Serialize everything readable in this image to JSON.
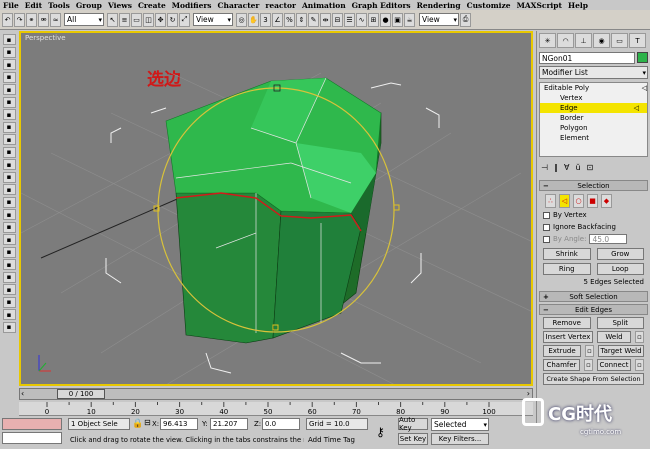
{
  "menu": [
    "File",
    "Edit",
    "Tools",
    "Group",
    "Views",
    "Create",
    "Modifiers",
    "Character",
    "reactor",
    "Animation",
    "Graph Editors",
    "Rendering",
    "Customize",
    "MAXScript",
    "Help"
  ],
  "toolbar": {
    "filter_select": "All",
    "coord_select": "View",
    "view_select_right": "View"
  },
  "viewport": {
    "label": "Perspective",
    "annotation": "选边"
  },
  "panel": {
    "object_name": "NGon01",
    "object_color": "#2db34a",
    "modifier_list": "Modifier List",
    "stack": {
      "root": "Editable Poly",
      "items": [
        "Vertex",
        "Edge",
        "Border",
        "Polygon",
        "Element"
      ],
      "selected": "Edge"
    },
    "selection": {
      "title": "Selection",
      "by_vertex": "By Vertex",
      "ignore_backfacing": "Ignore Backfacing",
      "by_angle": "By Angle:",
      "angle_value": "45.0",
      "shrink": "Shrink",
      "grow": "Grow",
      "ring": "Ring",
      "loop": "Loop",
      "status": "5 Edges Selected"
    },
    "soft_selection": "Soft Selection",
    "edit_edges": {
      "title": "Edit Edges",
      "remove": "Remove",
      "split": "Split",
      "insert_vertex": "Insert Vertex",
      "weld": "Weld",
      "extrude": "Extrude",
      "target_weld": "Target Weld",
      "chamfer": "Chamfer",
      "connect": "Connect",
      "create_shape": "Create Shape From Selection"
    }
  },
  "timeline": {
    "frame": "0 / 100",
    "ticks": [
      "0",
      "10",
      "20",
      "30",
      "40",
      "50",
      "60",
      "70",
      "80",
      "90",
      "100"
    ]
  },
  "status": {
    "selection": "1 Object Sele",
    "x_label": "X:",
    "x": "96.413",
    "y_label": "Y:",
    "y": "21.207",
    "z_label": "Z:",
    "z": "0.0",
    "grid": "Grid = 10.0",
    "prompt": "Click and drag to rotate the view. Clicking in the tabs constrains the rotation",
    "add_time_tag": "Add Time Tag",
    "auto_key": "Auto Key",
    "set_key": "Set Key",
    "selected_dropdown": "Selected",
    "key_filters": "Key Filters..."
  },
  "watermark": {
    "text": "CG时代",
    "url": "cgtimo.com"
  }
}
